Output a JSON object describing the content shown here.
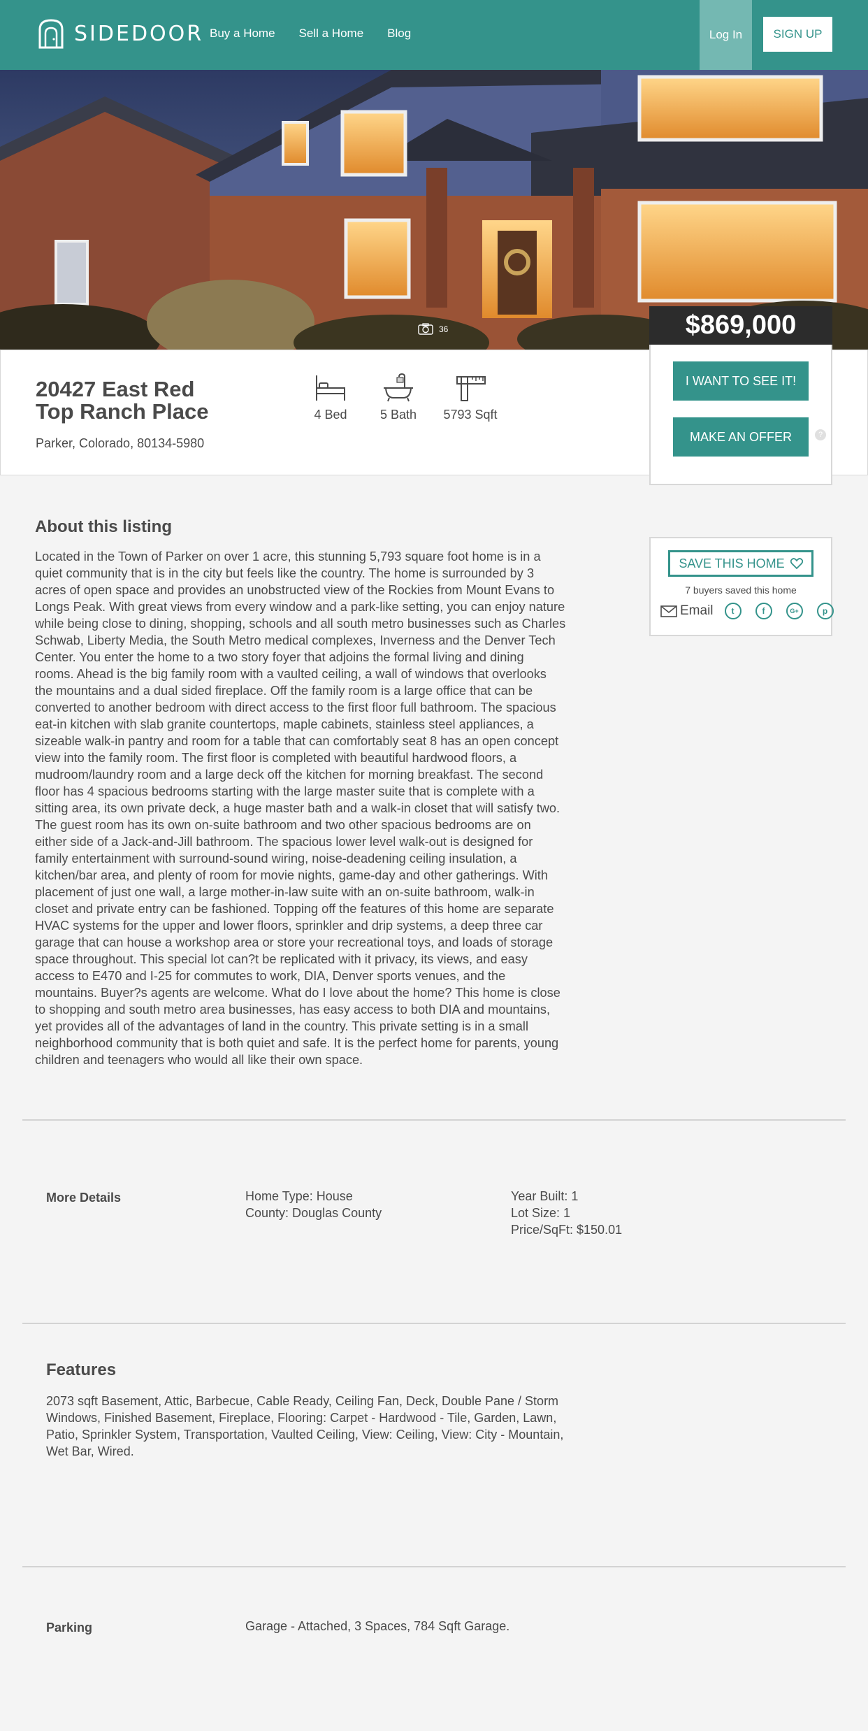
{
  "header": {
    "logo_text": "SIDEDOOR",
    "nav": [
      "Buy a Home",
      "Sell a Home",
      "Blog"
    ],
    "login": "Log In",
    "signup": "SIGN UP"
  },
  "hero": {
    "photo_count": "36"
  },
  "listing": {
    "address_line1": "20427 East Red",
    "address_line2": "Top Ranch Place",
    "city": "Parker, Colorado, 80134-5980",
    "stats": [
      {
        "icon": "bed-icon",
        "label": "4 Bed"
      },
      {
        "icon": "bathtub-icon",
        "label": "5 Bath"
      },
      {
        "icon": "square-footage-icon",
        "label": "5793 Sqft"
      }
    ]
  },
  "price_card": {
    "price": "$869,000",
    "see_button": "I WANT TO SEE IT!",
    "offer_button": "MAKE AN OFFER",
    "help": "?"
  },
  "about": {
    "title": "About this listing",
    "body": "Located in the Town of Parker on over 1 acre, this stunning 5,793 square foot home is in a quiet community that is in the city but feels like the country. The home is surrounded by 3 acres of open space and provides an unobstructed view of the Rockies from Mount Evans to Longs Peak. With great views from every window and a park-like setting, you can enjoy nature while being close to dining, shopping, schools and all south metro businesses such as Charles Schwab, Liberty Media, the South Metro medical complexes, Inverness and the Denver Tech Center. You enter the home to a two story foyer that adjoins the formal living and dining rooms. Ahead is the big family room with a vaulted ceiling, a wall of windows that overlooks the mountains and a dual sided fireplace. Off the family room is a large office that can be converted to another bedroom with direct access to the first floor full bathroom. The spacious eat-in kitchen with slab granite countertops, maple cabinets, stainless steel appliances, a sizeable walk-in pantry and room for a table that can comfortably seat 8 has an open concept view into the family room. The first floor is completed with beautiful hardwood floors, a mudroom/laundry room and a large deck off the kitchen for morning breakfast. The second floor has 4 spacious bedrooms starting with the large master suite that is complete with a sitting area, its own private deck, a huge master bath and a walk-in closet that will satisfy two. The guest room has its own on-suite bathroom and two other spacious bedrooms are on either side of a Jack-and-Jill bathroom. The spacious lower level walk-out is designed for family entertainment with surround-sound wiring, noise-deadening ceiling insulation, a kitchen/bar area, and plenty of room for movie nights, game-day and other gatherings. With placement of just one wall, a large mother-in-law suite with an on-suite bathroom, walk-in closet and private entry can be fashioned. Topping off the features of this home are separate HVAC systems for the upper and lower floors, sprinkler and drip systems, a deep three car garage that can house a workshop area or store your recreational toys, and loads of storage space throughout. This special lot can?t be replicated with it privacy, its views, and easy access to E470 and I-25 for commutes to work, DIA, Denver sports venues, and the mountains. Buyer?s agents are welcome. What do I love about the home? This home is close to shopping and south metro area businesses, has easy access to both DIA and mountains, yet provides all of the advantages of land in the country. This private setting is in a small neighborhood community that is both quiet and safe. It is the perfect home for parents, young children and teenagers who would all like their own space."
  },
  "save_card": {
    "save_button": "SAVE THIS HOME",
    "saved_count": "7 buyers saved this home",
    "email_label": "Email",
    "socials": [
      {
        "icon": "twitter-icon",
        "glyph": "t"
      },
      {
        "icon": "facebook-icon",
        "glyph": "f"
      },
      {
        "icon": "google-plus-icon",
        "glyph": "G+"
      },
      {
        "icon": "pinterest-icon",
        "glyph": "p"
      }
    ]
  },
  "more_details": {
    "label": "More Details",
    "col1": [
      "Home Type: House",
      "County: Douglas County"
    ],
    "col2": [
      "Year Built: 1",
      "Lot Size: 1",
      "Price/SqFt: $150.01"
    ]
  },
  "features": {
    "title": "Features",
    "body": "2073 sqft Basement, Attic, Barbecue, Cable Ready, Ceiling Fan, Deck, Double Pane / Storm Windows, Finished Basement, Fireplace, Flooring: Carpet - Hardwood - Tile, Garden, Lawn, Patio, Sprinkler System, Transportation, Vaulted Ceiling, View: Ceiling, View: City - Mountain, Wet Bar, Wired."
  },
  "parking": {
    "label": "Parking",
    "text": "Garage - Attached, 3 Spaces, 784 Sqft Garage."
  }
}
